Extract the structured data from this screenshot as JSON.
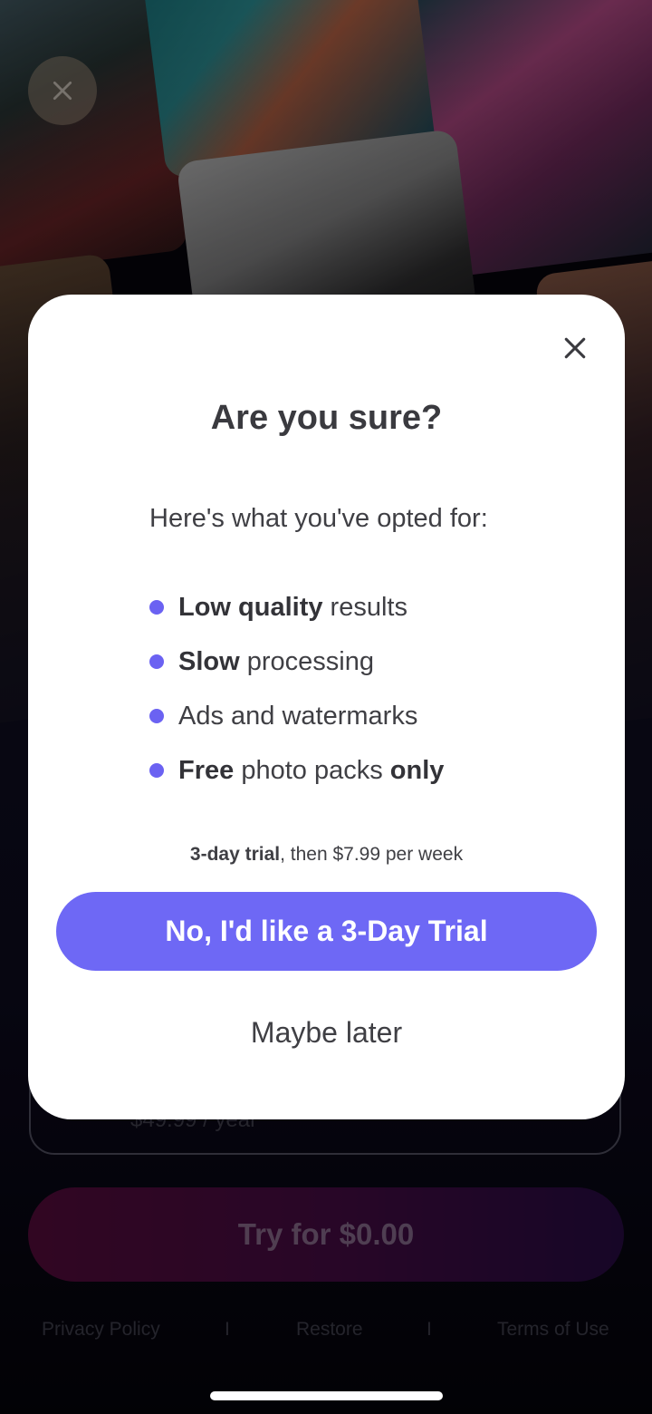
{
  "background": {
    "close_icon": "close-icon",
    "plan_price": "$49.99 / year",
    "cta_label": "Try for $0.00",
    "footer": {
      "privacy": "Privacy Policy",
      "separator": "I",
      "restore": "Restore",
      "terms": "Terms of Use"
    }
  },
  "modal": {
    "close_icon": "close-icon",
    "title": "Are you sure?",
    "intro": "Here's what you've opted for:",
    "features": [
      {
        "bold": "Low quality",
        "rest": " results"
      },
      {
        "bold": "Slow",
        "rest": " processing"
      },
      {
        "plain": "Ads and watermarks"
      },
      {
        "bold": "Free",
        "middle": " photo packs ",
        "bold2": "only"
      }
    ],
    "trial_note": {
      "bold": "3-day trial",
      "rest": ", then $7.99 per week"
    },
    "primary_button": "No, I'd like a 3-Day Trial",
    "secondary_button": "Maybe later"
  },
  "colors": {
    "accent": "#6e68f5",
    "bullet": "#6b62f2",
    "cta_gradient_start": "#5a0b3f",
    "cta_gradient_end": "#2a0b48"
  }
}
